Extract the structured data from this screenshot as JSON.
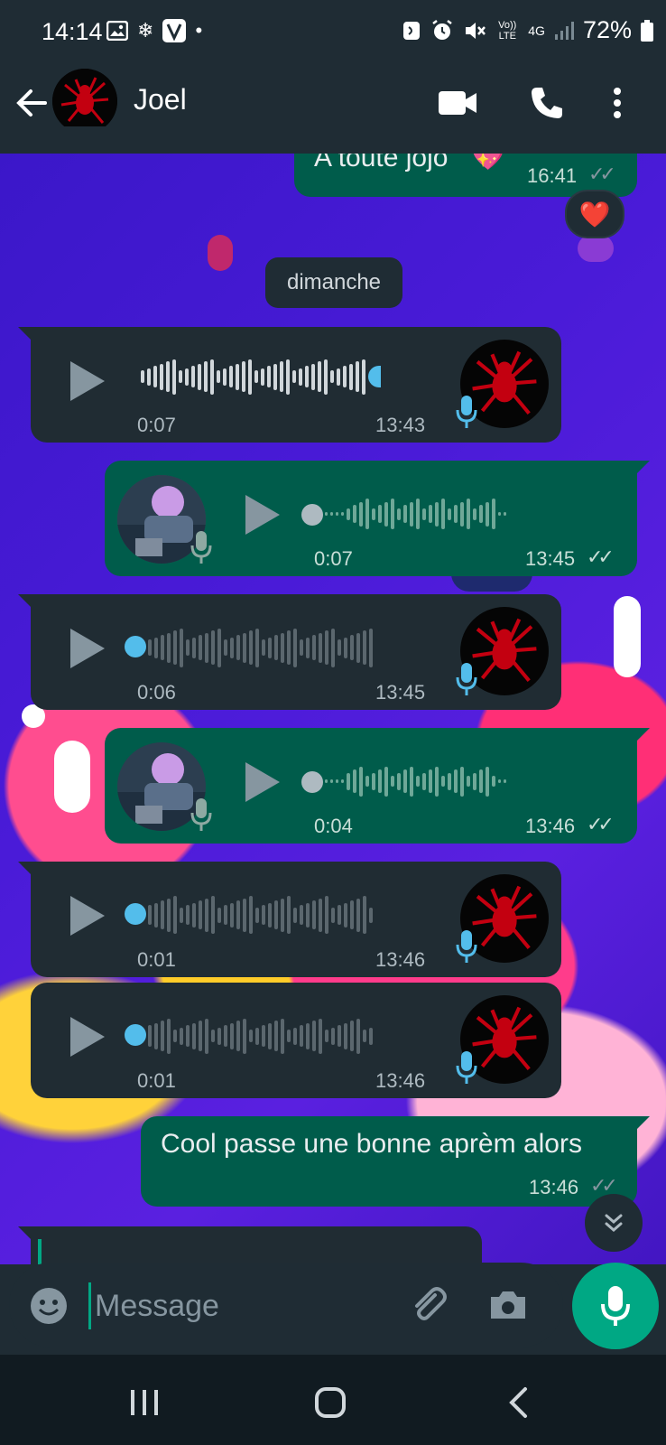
{
  "status_bar": {
    "time": "14:14",
    "battery": "72%",
    "network": "4G",
    "volte": "Vo)) LTE",
    "left_icons": [
      "image-icon",
      "snowflake-icon",
      "v-app-icon",
      "dot-icon"
    ],
    "right_icons": [
      "nfc-icon",
      "alarm-icon",
      "mute-icon",
      "signal-icon",
      "battery-icon"
    ]
  },
  "header": {
    "contact_name": "Joel",
    "actions": [
      "back-arrow-icon",
      "video-call-icon",
      "phone-icon",
      "more-vert-icon"
    ]
  },
  "messages": [
    {
      "type": "text",
      "direction": "out",
      "text": "A toute jojo",
      "emoji": "💖",
      "time": "16:41",
      "reaction": "❤️"
    },
    {
      "type": "date",
      "text": "dimanche"
    },
    {
      "type": "voice",
      "direction": "in",
      "duration": "0:07",
      "time": "13:43",
      "played": true
    },
    {
      "type": "voice",
      "direction": "out",
      "duration": "0:07",
      "time": "13:45"
    },
    {
      "type": "voice",
      "direction": "in",
      "duration": "0:06",
      "time": "13:45",
      "played": false
    },
    {
      "type": "voice",
      "direction": "out",
      "duration": "0:04",
      "time": "13:46"
    },
    {
      "type": "voice",
      "direction": "in",
      "duration": "0:01",
      "time": "13:46",
      "played": false
    },
    {
      "type": "voice",
      "direction": "in",
      "duration": "0:01",
      "time": "13:46",
      "played": false
    },
    {
      "type": "text",
      "direction": "out",
      "text": "Cool passe une bonne aprèm alors",
      "time": "13:46"
    }
  ],
  "composer": {
    "placeholder": "Message"
  },
  "colors": {
    "accent": "#00a884",
    "incoming": "#202c33",
    "outgoing": "#005c4b",
    "header": "#1f2c34",
    "wave_played": "#53bdeb"
  }
}
